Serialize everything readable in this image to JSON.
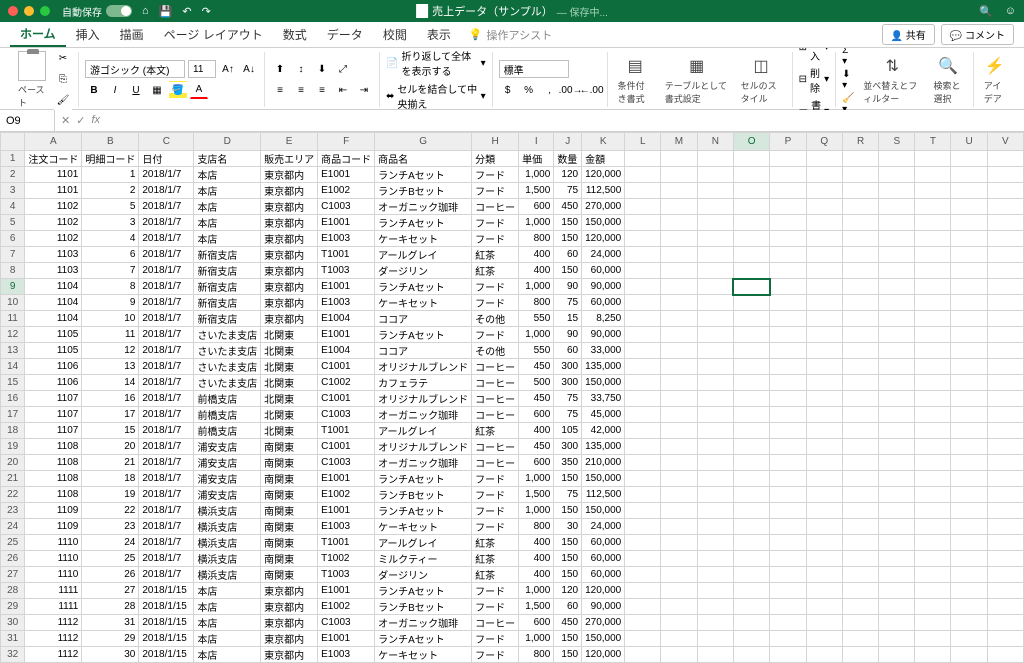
{
  "title_bar": {
    "autosave_label": "自動保存",
    "autosave_on": "オン",
    "document_name": "売上データ（サンプル）",
    "saving_status": "— 保存中..."
  },
  "tabs": {
    "items": [
      "ホーム",
      "挿入",
      "描画",
      "ページ レイアウト",
      "数式",
      "データ",
      "校閲",
      "表示"
    ],
    "active_index": 0,
    "tell_me": "操作アシスト",
    "share": "共有",
    "comment": "コメント"
  },
  "ribbon": {
    "paste": "ペースト",
    "font_name": "游ゴシック (本文)",
    "font_size": "11",
    "wrap": "折り返して全体を表示する",
    "merge": "セルを結合して中央揃え",
    "number_format": "標準",
    "cond_fmt": "条件付き書式",
    "table_fmt": "テーブルとして書式設定",
    "cell_style": "セルのスタイル",
    "insert": "挿入",
    "delete": "削除",
    "format": "書式",
    "sort_filter": "並べ替えとフィルター",
    "find_select": "検索と選択",
    "ideas": "アイデア"
  },
  "formula_bar": {
    "name": "O9",
    "formula": ""
  },
  "grid": {
    "columns": [
      "A",
      "B",
      "C",
      "D",
      "E",
      "F",
      "G",
      "H",
      "I",
      "J",
      "K",
      "L",
      "M",
      "N",
      "O",
      "P",
      "Q",
      "R",
      "S",
      "T",
      "U",
      "V"
    ],
    "headers": [
      "注文コード",
      "明細コード",
      "日付",
      "支店名",
      "販売エリア",
      "商品コード",
      "商品名",
      "分類",
      "単価",
      "数量",
      "金額"
    ],
    "selected_cell": {
      "col": "O",
      "row": 9
    },
    "rows": [
      [
        "1101",
        "1",
        "2018/1/7",
        "本店",
        "東京都内",
        "E1001",
        "ランチAセット",
        "フード",
        "1,000",
        "120",
        "120,000"
      ],
      [
        "1101",
        "2",
        "2018/1/7",
        "本店",
        "東京都内",
        "E1002",
        "ランチBセット",
        "フード",
        "1,500",
        "75",
        "112,500"
      ],
      [
        "1102",
        "5",
        "2018/1/7",
        "本店",
        "東京都内",
        "C1003",
        "オーガニック珈琲",
        "コーヒー",
        "600",
        "450",
        "270,000"
      ],
      [
        "1102",
        "3",
        "2018/1/7",
        "本店",
        "東京都内",
        "E1001",
        "ランチAセット",
        "フード",
        "1,000",
        "150",
        "150,000"
      ],
      [
        "1102",
        "4",
        "2018/1/7",
        "本店",
        "東京都内",
        "E1003",
        "ケーキセット",
        "フード",
        "800",
        "150",
        "120,000"
      ],
      [
        "1103",
        "6",
        "2018/1/7",
        "新宿支店",
        "東京都内",
        "T1001",
        "アールグレイ",
        "紅茶",
        "400",
        "60",
        "24,000"
      ],
      [
        "1103",
        "7",
        "2018/1/7",
        "新宿支店",
        "東京都内",
        "T1003",
        "ダージリン",
        "紅茶",
        "400",
        "150",
        "60,000"
      ],
      [
        "1104",
        "8",
        "2018/1/7",
        "新宿支店",
        "東京都内",
        "E1001",
        "ランチAセット",
        "フード",
        "1,000",
        "90",
        "90,000"
      ],
      [
        "1104",
        "9",
        "2018/1/7",
        "新宿支店",
        "東京都内",
        "E1003",
        "ケーキセット",
        "フード",
        "800",
        "75",
        "60,000"
      ],
      [
        "1104",
        "10",
        "2018/1/7",
        "新宿支店",
        "東京都内",
        "E1004",
        "ココア",
        "その他",
        "550",
        "15",
        "8,250"
      ],
      [
        "1105",
        "11",
        "2018/1/7",
        "さいたま支店",
        "北関東",
        "E1001",
        "ランチAセット",
        "フード",
        "1,000",
        "90",
        "90,000"
      ],
      [
        "1105",
        "12",
        "2018/1/7",
        "さいたま支店",
        "北関東",
        "E1004",
        "ココア",
        "その他",
        "550",
        "60",
        "33,000"
      ],
      [
        "1106",
        "13",
        "2018/1/7",
        "さいたま支店",
        "北関東",
        "C1001",
        "オリジナルブレンド",
        "コーヒー",
        "450",
        "300",
        "135,000"
      ],
      [
        "1106",
        "14",
        "2018/1/7",
        "さいたま支店",
        "北関東",
        "C1002",
        "カフェラテ",
        "コーヒー",
        "500",
        "300",
        "150,000"
      ],
      [
        "1107",
        "16",
        "2018/1/7",
        "前橋支店",
        "北関東",
        "C1001",
        "オリジナルブレンド",
        "コーヒー",
        "450",
        "75",
        "33,750"
      ],
      [
        "1107",
        "17",
        "2018/1/7",
        "前橋支店",
        "北関東",
        "C1003",
        "オーガニック珈琲",
        "コーヒー",
        "600",
        "75",
        "45,000"
      ],
      [
        "1107",
        "15",
        "2018/1/7",
        "前橋支店",
        "北関東",
        "T1001",
        "アールグレイ",
        "紅茶",
        "400",
        "105",
        "42,000"
      ],
      [
        "1108",
        "20",
        "2018/1/7",
        "浦安支店",
        "南関東",
        "C1001",
        "オリジナルブレンド",
        "コーヒー",
        "450",
        "300",
        "135,000"
      ],
      [
        "1108",
        "21",
        "2018/1/7",
        "浦安支店",
        "南関東",
        "C1003",
        "オーガニック珈琲",
        "コーヒー",
        "600",
        "350",
        "210,000"
      ],
      [
        "1108",
        "18",
        "2018/1/7",
        "浦安支店",
        "南関東",
        "E1001",
        "ランチAセット",
        "フード",
        "1,000",
        "150",
        "150,000"
      ],
      [
        "1108",
        "19",
        "2018/1/7",
        "浦安支店",
        "南関東",
        "E1002",
        "ランチBセット",
        "フード",
        "1,500",
        "75",
        "112,500"
      ],
      [
        "1109",
        "22",
        "2018/1/7",
        "横浜支店",
        "南関東",
        "E1001",
        "ランチAセット",
        "フード",
        "1,000",
        "150",
        "150,000"
      ],
      [
        "1109",
        "23",
        "2018/1/7",
        "横浜支店",
        "南関東",
        "E1003",
        "ケーキセット",
        "フード",
        "800",
        "30",
        "24,000"
      ],
      [
        "1110",
        "24",
        "2018/1/7",
        "横浜支店",
        "南関東",
        "T1001",
        "アールグレイ",
        "紅茶",
        "400",
        "150",
        "60,000"
      ],
      [
        "1110",
        "25",
        "2018/1/7",
        "横浜支店",
        "南関東",
        "T1002",
        "ミルクティー",
        "紅茶",
        "400",
        "150",
        "60,000"
      ],
      [
        "1110",
        "26",
        "2018/1/7",
        "横浜支店",
        "南関東",
        "T1003",
        "ダージリン",
        "紅茶",
        "400",
        "150",
        "60,000"
      ],
      [
        "1111",
        "27",
        "2018/1/15",
        "本店",
        "東京都内",
        "E1001",
        "ランチAセット",
        "フード",
        "1,000",
        "120",
        "120,000"
      ],
      [
        "1111",
        "28",
        "2018/1/15",
        "本店",
        "東京都内",
        "E1002",
        "ランチBセット",
        "フード",
        "1,500",
        "60",
        "90,000"
      ],
      [
        "1112",
        "31",
        "2018/1/15",
        "本店",
        "東京都内",
        "C1003",
        "オーガニック珈琲",
        "コーヒー",
        "600",
        "450",
        "270,000"
      ],
      [
        "1112",
        "29",
        "2018/1/15",
        "本店",
        "東京都内",
        "E1001",
        "ランチAセット",
        "フード",
        "1,000",
        "150",
        "150,000"
      ],
      [
        "1112",
        "30",
        "2018/1/15",
        "本店",
        "東京都内",
        "E1003",
        "ケーキセット",
        "フード",
        "800",
        "150",
        "120,000"
      ]
    ]
  }
}
